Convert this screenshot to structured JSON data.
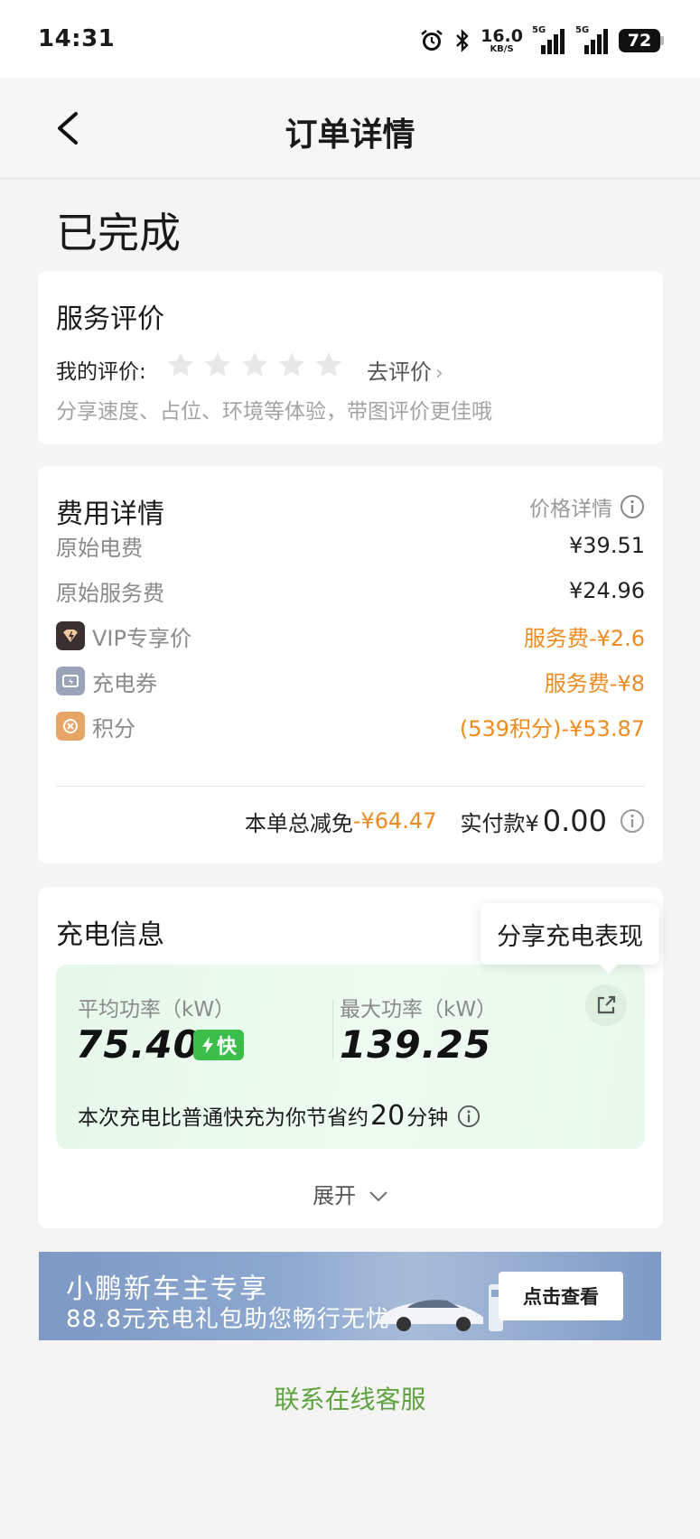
{
  "status_bar": {
    "time": "14:31",
    "net_speed": "16.0",
    "net_unit": "KB/S",
    "sig1_label": "5G",
    "sig2_label": "5G",
    "battery": "72"
  },
  "nav": {
    "title": "订单详情"
  },
  "order_status": "已完成",
  "review": {
    "title": "服务评价",
    "my_rating_label": "我的评价:",
    "rating": 0,
    "max_rating": 5,
    "go_review": "去评价",
    "hint": "分享速度、占位、环境等体验，带图评价更佳哦"
  },
  "fee": {
    "title": "费用详情",
    "price_detail": "价格详情",
    "rows": [
      {
        "label": "原始电费",
        "value": "¥39.51"
      },
      {
        "label": "原始服务费",
        "value": "¥24.96"
      },
      {
        "label": "VIP专享价",
        "value": "服务费-¥2.6"
      },
      {
        "label": "充电券",
        "value": "服务费-¥8"
      },
      {
        "label": "积分",
        "value": "(539积分)-¥53.87"
      }
    ],
    "total_discount_label": "本单总减免",
    "total_discount_value": "-¥64.47",
    "paid_label": "实付款¥",
    "paid_amount": "0.00"
  },
  "charge": {
    "title": "充电信息",
    "avg_power_label": "平均功率（kW）",
    "avg_power_value": "75.40",
    "fast_badge": "快",
    "max_power_label": "最大功率（kW）",
    "max_power_value": "139.25",
    "save_prefix": "本次充电比普通快充为你节省约",
    "save_minutes": "20",
    "save_suffix": "分钟",
    "expand": "展开",
    "share_tooltip": "分享充电表现"
  },
  "banner": {
    "title": "小鹏新车主专享",
    "subtitle": "88.8元充电礼包助您畅行无忧",
    "cta": "点击查看"
  },
  "contact": "联系在线客服",
  "colors": {
    "accent_orange": "#ee8b1f",
    "accent_green": "#5ea33f",
    "fast_green": "#3cbf4a"
  }
}
